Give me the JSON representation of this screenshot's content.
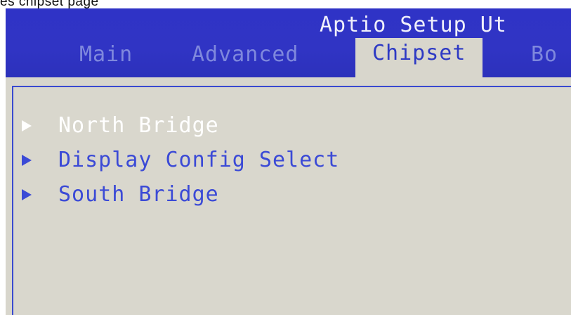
{
  "caption": "es  chipset  page",
  "app": {
    "title": "Aptio Setup Ut"
  },
  "tabs": [
    {
      "label": "Main",
      "active": false
    },
    {
      "label": "Advanced",
      "active": false
    },
    {
      "label": "Chipset",
      "active": true
    },
    {
      "label": "Bo",
      "active": false
    }
  ],
  "menu": {
    "items": [
      {
        "label": "North Bridge",
        "icon": "submenu-arrow-icon",
        "selected": true
      },
      {
        "label": "Display Config Select",
        "icon": "submenu-arrow-icon",
        "selected": false
      },
      {
        "label": "South Bridge",
        "icon": "submenu-arrow-icon",
        "selected": false
      }
    ]
  },
  "colors": {
    "header_bg": "#2f33c6",
    "content_bg": "#d8d6cc",
    "item_text": "#3b4ad6",
    "selected_text": "#ffffff",
    "inactive_tab": "#7f88dd",
    "title_text": "#f0f0fb"
  }
}
